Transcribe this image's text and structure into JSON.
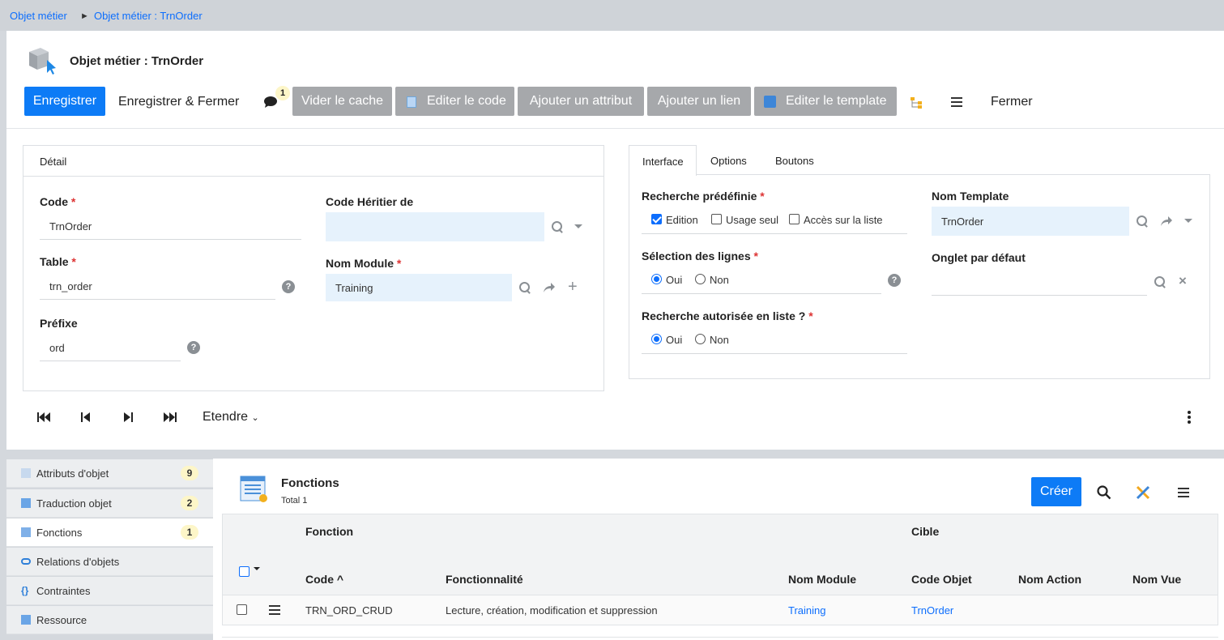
{
  "breadcrumb": {
    "root": "Objet métier",
    "separator": "►",
    "current": "Objet métier : TrnOrder"
  },
  "header": {
    "title": "Objet métier : TrnOrder"
  },
  "toolbar": {
    "save": "Enregistrer",
    "save_close": "Enregistrer & Fermer",
    "comment_count": "1",
    "clear_cache": "Vider le cache",
    "edit_code": "Editer le code",
    "add_attribute": "Ajouter un attribut",
    "add_link": "Ajouter un lien",
    "edit_template": "Editer le template",
    "close": "Fermer"
  },
  "detail": {
    "tab": "Détail",
    "code_label": "Code",
    "code_value": "TrnOrder",
    "table_label": "Table",
    "table_value": "trn_order",
    "prefix_label": "Préfixe",
    "prefix_value": "ord",
    "heir_label": "Code Héritier de",
    "heir_value": "",
    "module_label": "Nom Module",
    "module_value": "Training",
    "required_mark": "*"
  },
  "interface": {
    "tabs": [
      "Interface",
      "Options",
      "Boutons"
    ],
    "search_label": "Recherche prédéfinie",
    "search_options": [
      "Edition",
      "Usage seul",
      "Accès sur la liste"
    ],
    "template_label": "Nom Template",
    "template_value": "TrnOrder",
    "selection_label": "Sélection des lignes",
    "default_tab_label": "Onglet par défaut",
    "list_search_label": "Recherche autorisée en liste ?",
    "yes": "Oui",
    "no": "Non"
  },
  "nav": {
    "extend": "Etendre"
  },
  "sidebar": {
    "items": [
      {
        "label": "Attributs d'objet",
        "badge": "9"
      },
      {
        "label": "Traduction objet",
        "badge": "2"
      },
      {
        "label": "Fonctions",
        "badge": "1"
      },
      {
        "label": "Relations d'objets",
        "badge": ""
      },
      {
        "label": "Contraintes",
        "badge": ""
      },
      {
        "label": "Ressource",
        "badge": ""
      }
    ]
  },
  "functions": {
    "title": "Fonctions",
    "total": "Total 1",
    "create": "Créer",
    "group_function": "Fonction",
    "group_target": "Cible",
    "columns": [
      "Code",
      "Fonctionnalité",
      "Nom Module",
      "Code Objet",
      "Nom Action",
      "Nom Vue"
    ],
    "sort_indicator": "^",
    "rows": [
      {
        "code": "TRN_ORD_CRUD",
        "feature": "Lecture, création, modification et suppression",
        "module": "Training",
        "object": "TrnOrder",
        "action": "",
        "view": ""
      }
    ]
  },
  "colors": {
    "primary": "#0d7bf6",
    "grey_button": "#a6a8ab",
    "field_bg": "#e6f2fc",
    "badge_bg": "#fdf6c8"
  },
  "icons": [
    "cube-cursor-icon",
    "comment-icon",
    "code-file-icon",
    "template-edit-icon",
    "tree-icon",
    "menu-icon",
    "search-icon",
    "dropdown-caret-icon",
    "share-icon",
    "plus-icon",
    "help-icon",
    "clear-icon",
    "first-icon",
    "prev-icon",
    "next-icon",
    "last-icon",
    "kebab-icon",
    "functions-list-icon",
    "tools-icon"
  ]
}
